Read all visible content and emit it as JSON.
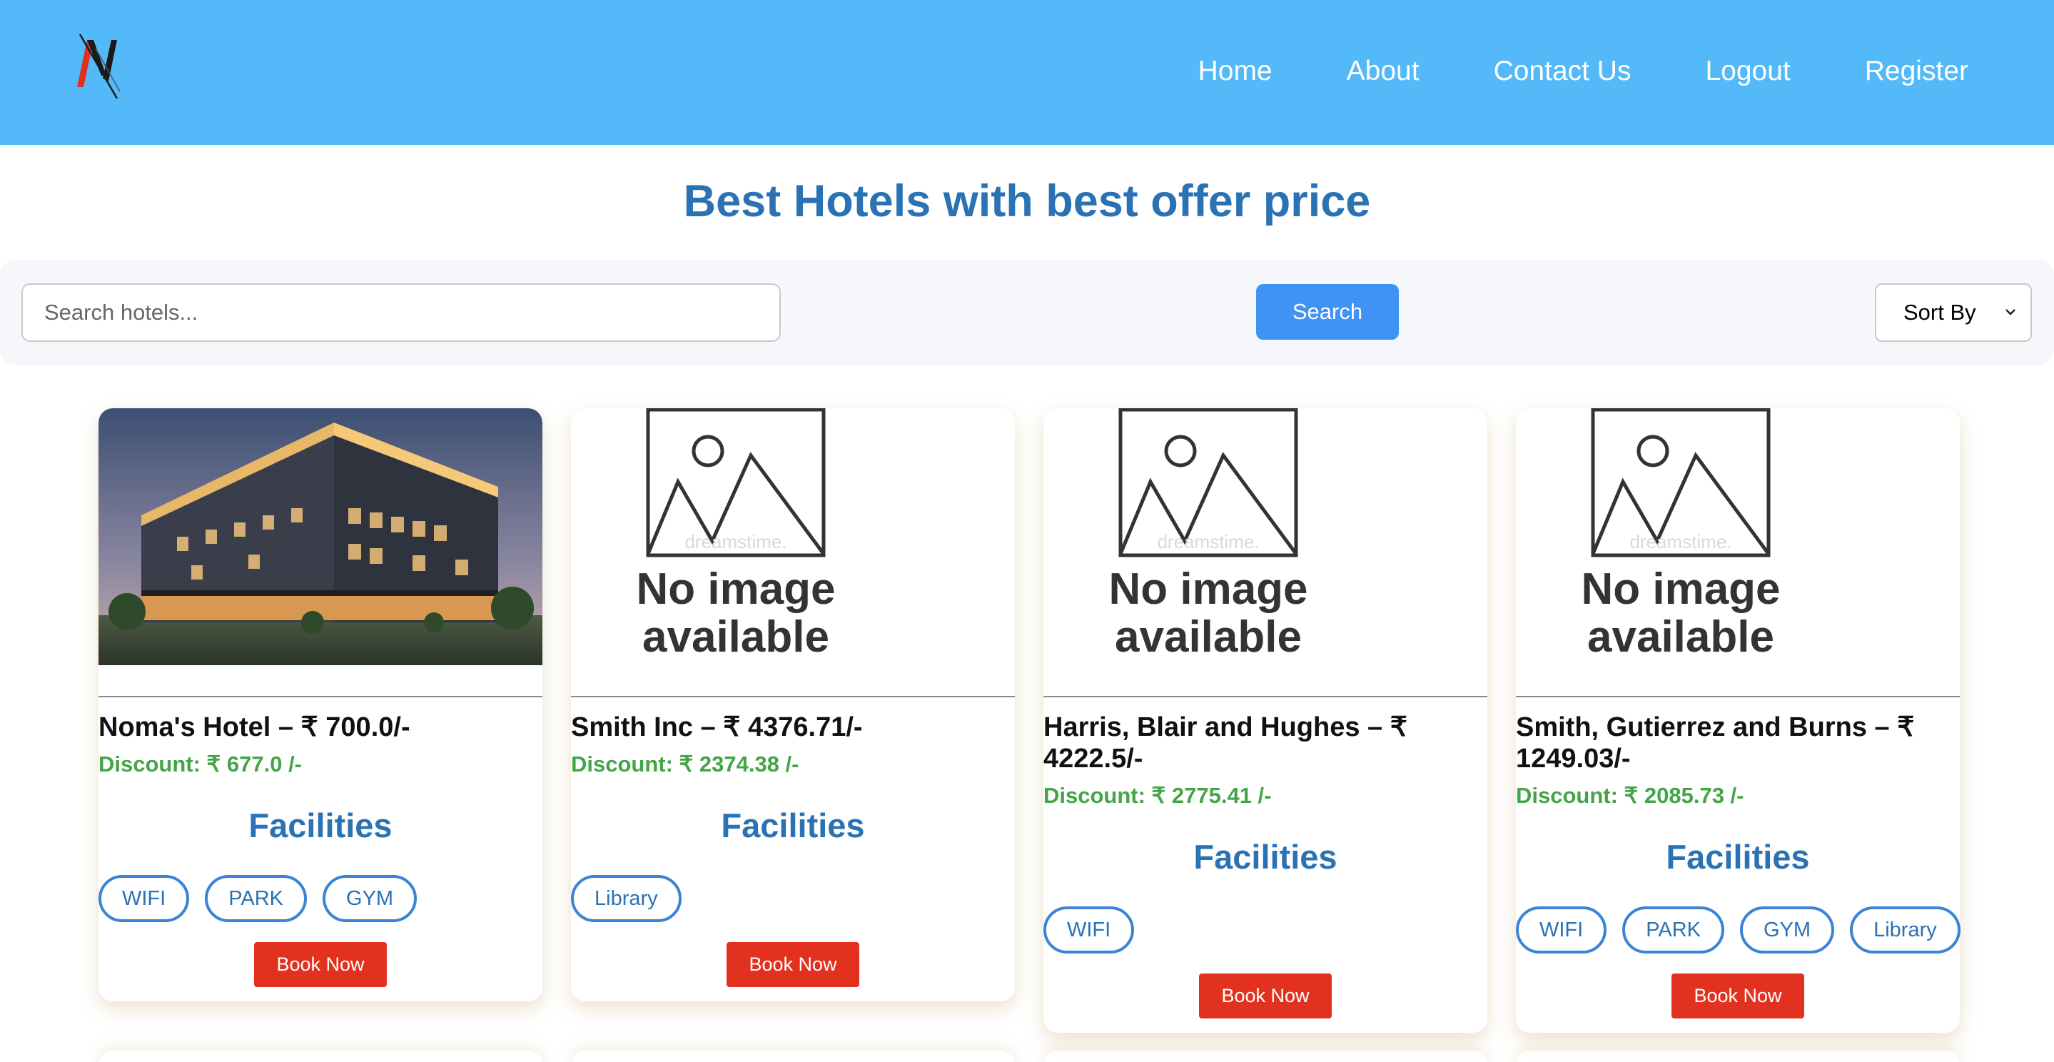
{
  "nav": {
    "items": [
      "Home",
      "About",
      "Contact Us",
      "Logout",
      "Register"
    ]
  },
  "page": {
    "title": "Best Hotels with best offer price"
  },
  "search": {
    "placeholder": "Search hotels...",
    "value": "",
    "button_label": "Search",
    "sort_label": "Sort By"
  },
  "no_image": {
    "line1": "No image",
    "line2": "available",
    "watermark": "dreamstime."
  },
  "hotels": [
    {
      "title": "Noma's Hotel – ₹ 700.0/-",
      "discount": "Discount: ₹ 677.0 /-",
      "facilities_heading": "Facilities",
      "facilities": [
        "WIFI",
        "PARK",
        "GYM"
      ],
      "book_label": "Book Now",
      "has_image": true
    },
    {
      "title": "Smith Inc – ₹ 4376.71/-",
      "discount": "Discount: ₹ 2374.38 /-",
      "facilities_heading": "Facilities",
      "facilities": [
        "Library"
      ],
      "book_label": "Book Now",
      "has_image": false
    },
    {
      "title": "Harris, Blair and Hughes – ₹ 4222.5/-",
      "discount": "Discount: ₹ 2775.41 /-",
      "facilities_heading": "Facilities",
      "facilities": [
        "WIFI"
      ],
      "book_label": "Book Now",
      "has_image": false
    },
    {
      "title": "Smith, Gutierrez and Burns – ₹ 1249.03/-",
      "discount": "Discount: ₹ 2085.73 /-",
      "facilities_heading": "Facilities",
      "facilities": [
        "WIFI",
        "PARK",
        "GYM",
        "Library"
      ],
      "book_label": "Book Now",
      "has_image": false
    }
  ],
  "colors": {
    "header_bg": "#53b9f8",
    "title": "#2a72b4",
    "discount": "#44a448",
    "search_button": "#3e93f5",
    "book_button": "#e2321f",
    "chip_border": "#3a84d6"
  }
}
